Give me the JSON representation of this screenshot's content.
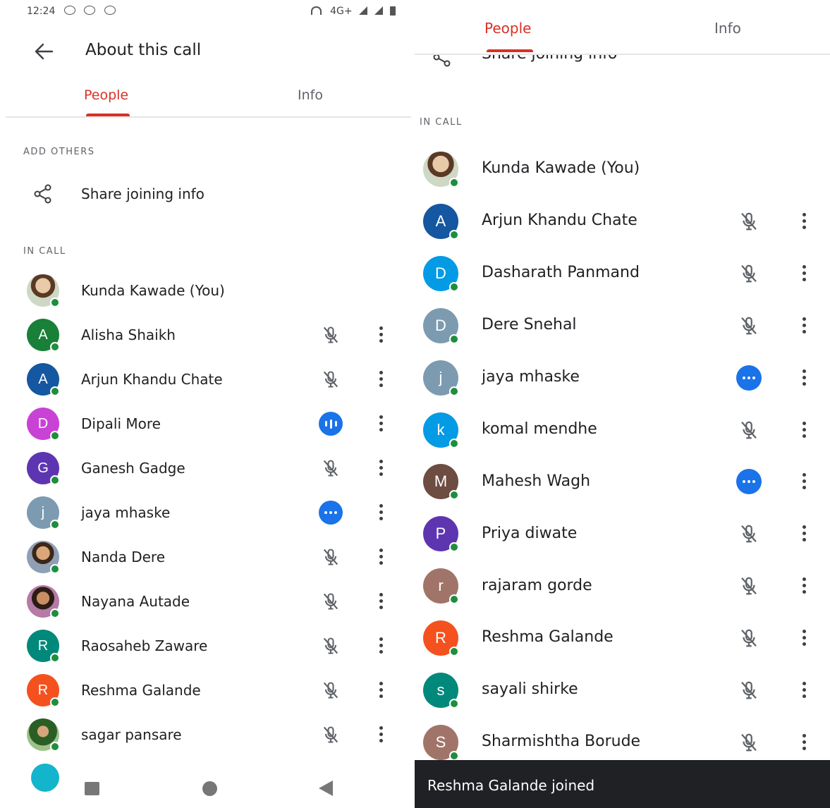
{
  "left": {
    "status": {
      "time": "12:24",
      "network": "4G+"
    },
    "title": "About this call",
    "tabs": [
      {
        "label": "People",
        "active": true
      },
      {
        "label": "Info",
        "active": false
      }
    ],
    "add_others": "ADD OTHERS",
    "share_label": "Share joining info",
    "in_call": "IN CALL",
    "participants": [
      {
        "name": "Kunda Kawade (You)",
        "initial": "",
        "color": "",
        "photo": "photo",
        "state": "self"
      },
      {
        "name": "Alisha Shaikh",
        "initial": "A",
        "color": "#188038",
        "state": "muted"
      },
      {
        "name": "Arjun Khandu Chate",
        "initial": "A",
        "color": "#1557a0",
        "state": "muted"
      },
      {
        "name": "Dipali More",
        "initial": "D",
        "color": "#c942d6",
        "state": "speaking"
      },
      {
        "name": "Ganesh Gadge",
        "initial": "G",
        "color": "#5e35b1",
        "state": "muted"
      },
      {
        "name": "jaya mhaske",
        "initial": "j",
        "color": "#7d9bb0",
        "state": "more"
      },
      {
        "name": "Nanda Dere",
        "initial": "",
        "color": "",
        "photo": "photo2",
        "state": "muted"
      },
      {
        "name": "Nayana Autade",
        "initial": "",
        "color": "",
        "photo": "photo3",
        "state": "muted"
      },
      {
        "name": "Raosaheb Zaware",
        "initial": "R",
        "color": "#00897b",
        "state": "muted"
      },
      {
        "name": "Reshma Galande",
        "initial": "R",
        "color": "#f4511e",
        "state": "muted"
      },
      {
        "name": "sagar pansare",
        "initial": "",
        "color": "",
        "photo": "photo4",
        "state": "muted"
      }
    ]
  },
  "right": {
    "tabs": [
      {
        "label": "People",
        "active": true
      },
      {
        "label": "Info",
        "active": false
      }
    ],
    "share_label_partial": "Share joining info",
    "in_call": "IN CALL",
    "participants": [
      {
        "name": "Kunda Kawade (You)",
        "initial": "",
        "color": "",
        "photo": "photo",
        "state": "self"
      },
      {
        "name": "Arjun Khandu Chate",
        "initial": "A",
        "color": "#1557a0",
        "state": "muted"
      },
      {
        "name": "Dasharath Panmand",
        "initial": "D",
        "color": "#039be5",
        "state": "muted"
      },
      {
        "name": "Dere Snehal",
        "initial": "D",
        "color": "#7d9bb0",
        "state": "muted"
      },
      {
        "name": "jaya mhaske",
        "initial": "j",
        "color": "#7d9bb0",
        "state": "more"
      },
      {
        "name": "komal mendhe",
        "initial": "k",
        "color": "#039be5",
        "state": "muted"
      },
      {
        "name": "Mahesh Wagh",
        "initial": "M",
        "color": "#6d4c41",
        "state": "more"
      },
      {
        "name": "Priya diwate",
        "initial": "P",
        "color": "#5e35b1",
        "state": "muted"
      },
      {
        "name": "rajaram gorde",
        "initial": "r",
        "color": "#a1746a",
        "state": "muted"
      },
      {
        "name": "Reshma Galande",
        "initial": "R",
        "color": "#f4511e",
        "state": "muted"
      },
      {
        "name": "sayali shirke",
        "initial": "s",
        "color": "#00897b",
        "state": "muted"
      },
      {
        "name": "Sharmishtha Borude",
        "initial": "S",
        "color": "#a1746a",
        "state": "muted"
      }
    ],
    "snackbar": "Reshma Galande joined"
  }
}
